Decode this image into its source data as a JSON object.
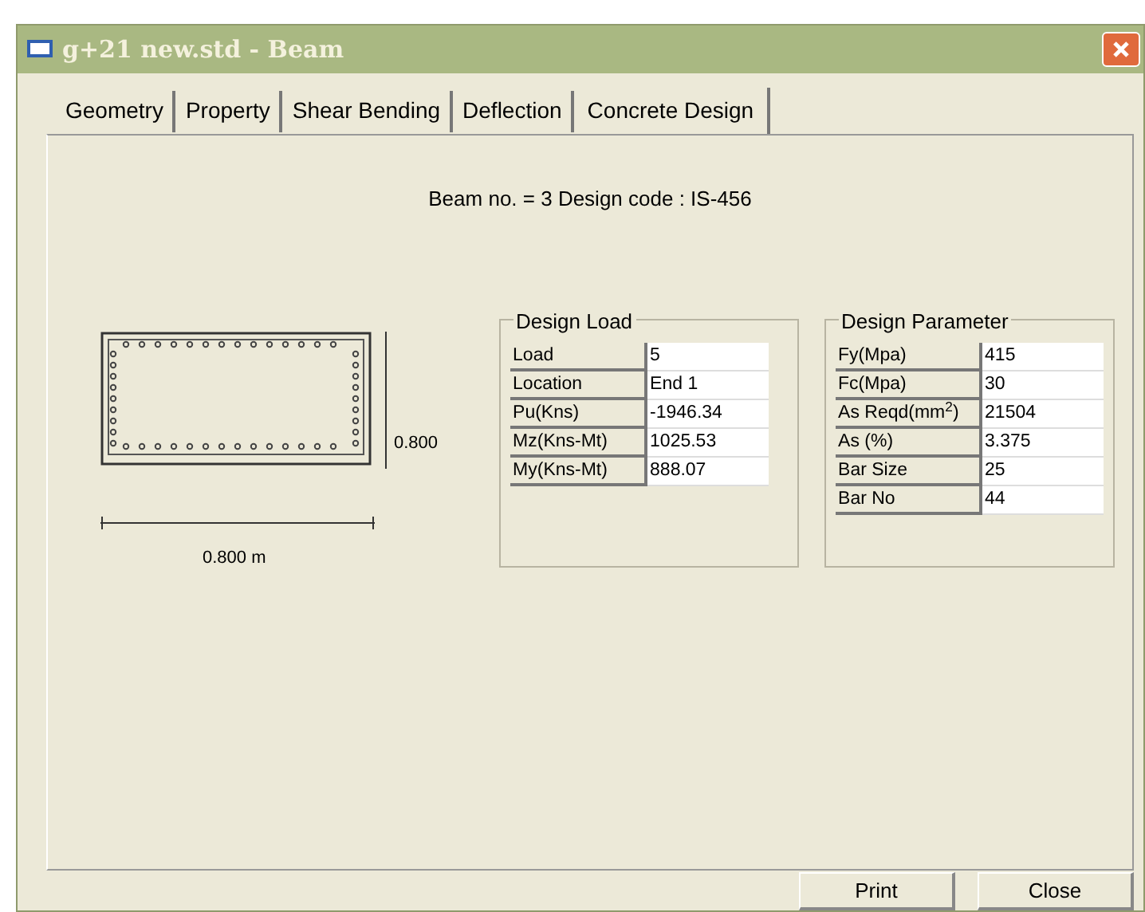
{
  "window": {
    "title": "g+21 new.std - Beam"
  },
  "tabs": [
    {
      "label": "Geometry",
      "selected": false
    },
    {
      "label": "Property",
      "selected": false
    },
    {
      "label": "Shear Bending",
      "selected": false
    },
    {
      "label": "Deflection",
      "selected": false
    },
    {
      "label": "Concrete Design",
      "selected": true
    }
  ],
  "heading": "Beam no. = 3  Design code :  IS-456",
  "section": {
    "height_label": "0.800",
    "width_label": "0.800 m"
  },
  "design_load": {
    "title": "Design Load",
    "rows": [
      {
        "label": "Load",
        "value": "5"
      },
      {
        "label": "Location",
        "value": "End 1"
      },
      {
        "label": "Pu(Kns)",
        "value": "-1946.34"
      },
      {
        "label": "Mz(Kns-Mt)",
        "value": "1025.53"
      },
      {
        "label": "My(Kns-Mt)",
        "value": "888.07"
      }
    ]
  },
  "design_parameter": {
    "title": "Design Parameter",
    "rows": [
      {
        "label": "Fy(Mpa)",
        "value": "415"
      },
      {
        "label": "Fc(Mpa)",
        "value": "30"
      },
      {
        "label": "As Reqd(mm$^{2}$)",
        "value": "21504"
      },
      {
        "label": "As (%)",
        "value": "3.375"
      },
      {
        "label": "Bar Size",
        "value": "25"
      },
      {
        "label": "Bar No",
        "value": "44"
      }
    ]
  },
  "buttons": [
    "Print",
    "Close"
  ]
}
